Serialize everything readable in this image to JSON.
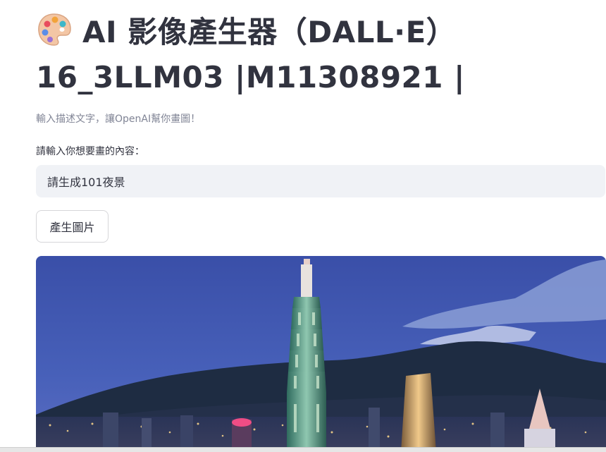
{
  "header": {
    "icon": "artist-palette-icon",
    "title_line1": "AI 影像產生器（DALL·E）",
    "title_line2": "16_3LLM03 |M11308921 |"
  },
  "subtitle": "輸入描述文字，讓OpenAI幫你畫圖！",
  "prompt_field": {
    "label": "請輸入你想要畫的內容：",
    "value": "請生成101夜景"
  },
  "generate_button": {
    "label": "產生圖片"
  },
  "generated_image": {
    "subject": "taipei-101-night-view"
  },
  "colors": {
    "text": "#31333f",
    "muted": "#808495",
    "input_bg": "#f0f2f6",
    "border": "#d6d6d9"
  }
}
